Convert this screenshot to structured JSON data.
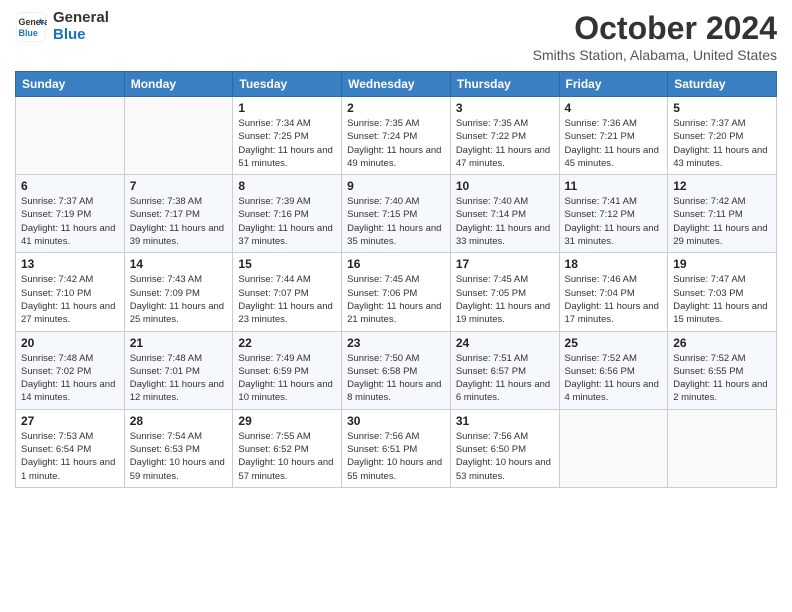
{
  "logo": {
    "general": "General",
    "blue": "Blue"
  },
  "title": "October 2024",
  "location": "Smiths Station, Alabama, United States",
  "days_of_week": [
    "Sunday",
    "Monday",
    "Tuesday",
    "Wednesday",
    "Thursday",
    "Friday",
    "Saturday"
  ],
  "weeks": [
    [
      {
        "day": "",
        "info": ""
      },
      {
        "day": "",
        "info": ""
      },
      {
        "day": "1",
        "info": "Sunrise: 7:34 AM\nSunset: 7:25 PM\nDaylight: 11 hours and 51 minutes."
      },
      {
        "day": "2",
        "info": "Sunrise: 7:35 AM\nSunset: 7:24 PM\nDaylight: 11 hours and 49 minutes."
      },
      {
        "day": "3",
        "info": "Sunrise: 7:35 AM\nSunset: 7:22 PM\nDaylight: 11 hours and 47 minutes."
      },
      {
        "day": "4",
        "info": "Sunrise: 7:36 AM\nSunset: 7:21 PM\nDaylight: 11 hours and 45 minutes."
      },
      {
        "day": "5",
        "info": "Sunrise: 7:37 AM\nSunset: 7:20 PM\nDaylight: 11 hours and 43 minutes."
      }
    ],
    [
      {
        "day": "6",
        "info": "Sunrise: 7:37 AM\nSunset: 7:19 PM\nDaylight: 11 hours and 41 minutes."
      },
      {
        "day": "7",
        "info": "Sunrise: 7:38 AM\nSunset: 7:17 PM\nDaylight: 11 hours and 39 minutes."
      },
      {
        "day": "8",
        "info": "Sunrise: 7:39 AM\nSunset: 7:16 PM\nDaylight: 11 hours and 37 minutes."
      },
      {
        "day": "9",
        "info": "Sunrise: 7:40 AM\nSunset: 7:15 PM\nDaylight: 11 hours and 35 minutes."
      },
      {
        "day": "10",
        "info": "Sunrise: 7:40 AM\nSunset: 7:14 PM\nDaylight: 11 hours and 33 minutes."
      },
      {
        "day": "11",
        "info": "Sunrise: 7:41 AM\nSunset: 7:12 PM\nDaylight: 11 hours and 31 minutes."
      },
      {
        "day": "12",
        "info": "Sunrise: 7:42 AM\nSunset: 7:11 PM\nDaylight: 11 hours and 29 minutes."
      }
    ],
    [
      {
        "day": "13",
        "info": "Sunrise: 7:42 AM\nSunset: 7:10 PM\nDaylight: 11 hours and 27 minutes."
      },
      {
        "day": "14",
        "info": "Sunrise: 7:43 AM\nSunset: 7:09 PM\nDaylight: 11 hours and 25 minutes."
      },
      {
        "day": "15",
        "info": "Sunrise: 7:44 AM\nSunset: 7:07 PM\nDaylight: 11 hours and 23 minutes."
      },
      {
        "day": "16",
        "info": "Sunrise: 7:45 AM\nSunset: 7:06 PM\nDaylight: 11 hours and 21 minutes."
      },
      {
        "day": "17",
        "info": "Sunrise: 7:45 AM\nSunset: 7:05 PM\nDaylight: 11 hours and 19 minutes."
      },
      {
        "day": "18",
        "info": "Sunrise: 7:46 AM\nSunset: 7:04 PM\nDaylight: 11 hours and 17 minutes."
      },
      {
        "day": "19",
        "info": "Sunrise: 7:47 AM\nSunset: 7:03 PM\nDaylight: 11 hours and 15 minutes."
      }
    ],
    [
      {
        "day": "20",
        "info": "Sunrise: 7:48 AM\nSunset: 7:02 PM\nDaylight: 11 hours and 14 minutes."
      },
      {
        "day": "21",
        "info": "Sunrise: 7:48 AM\nSunset: 7:01 PM\nDaylight: 11 hours and 12 minutes."
      },
      {
        "day": "22",
        "info": "Sunrise: 7:49 AM\nSunset: 6:59 PM\nDaylight: 11 hours and 10 minutes."
      },
      {
        "day": "23",
        "info": "Sunrise: 7:50 AM\nSunset: 6:58 PM\nDaylight: 11 hours and 8 minutes."
      },
      {
        "day": "24",
        "info": "Sunrise: 7:51 AM\nSunset: 6:57 PM\nDaylight: 11 hours and 6 minutes."
      },
      {
        "day": "25",
        "info": "Sunrise: 7:52 AM\nSunset: 6:56 PM\nDaylight: 11 hours and 4 minutes."
      },
      {
        "day": "26",
        "info": "Sunrise: 7:52 AM\nSunset: 6:55 PM\nDaylight: 11 hours and 2 minutes."
      }
    ],
    [
      {
        "day": "27",
        "info": "Sunrise: 7:53 AM\nSunset: 6:54 PM\nDaylight: 11 hours and 1 minute."
      },
      {
        "day": "28",
        "info": "Sunrise: 7:54 AM\nSunset: 6:53 PM\nDaylight: 10 hours and 59 minutes."
      },
      {
        "day": "29",
        "info": "Sunrise: 7:55 AM\nSunset: 6:52 PM\nDaylight: 10 hours and 57 minutes."
      },
      {
        "day": "30",
        "info": "Sunrise: 7:56 AM\nSunset: 6:51 PM\nDaylight: 10 hours and 55 minutes."
      },
      {
        "day": "31",
        "info": "Sunrise: 7:56 AM\nSunset: 6:50 PM\nDaylight: 10 hours and 53 minutes."
      },
      {
        "day": "",
        "info": ""
      },
      {
        "day": "",
        "info": ""
      }
    ]
  ]
}
